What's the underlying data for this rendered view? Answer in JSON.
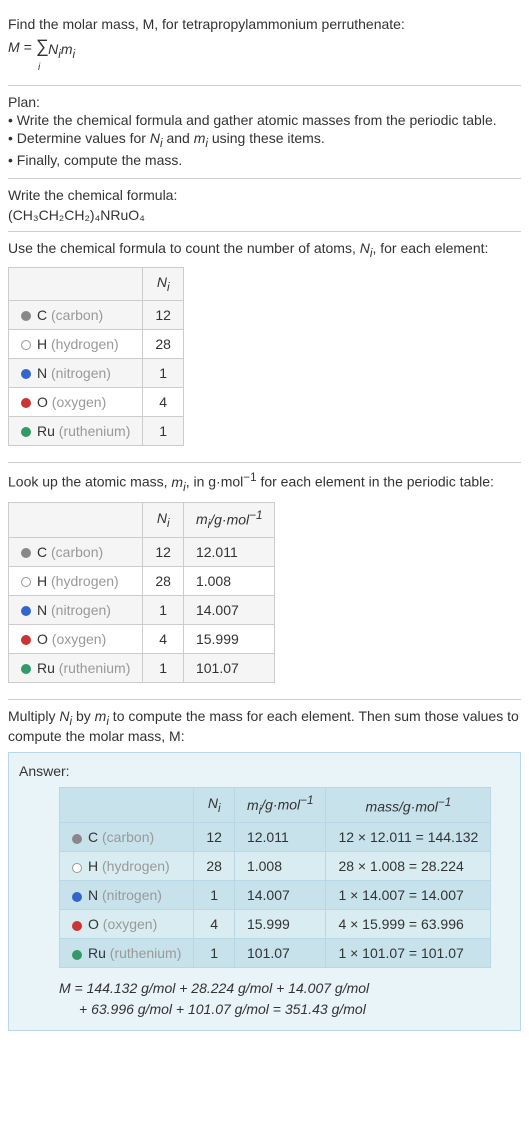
{
  "intro": {
    "line1": "Find the molar mass, M, for tetrapropylammonium perruthenate:",
    "formula_text": "M = ",
    "sigma": "∑",
    "sigma_sub": "i",
    "formula_rest": " Nᵢmᵢ"
  },
  "plan": {
    "heading": "Plan:",
    "item1": "• Write the chemical formula and gather atomic masses from the periodic table.",
    "item2_pre": "• Determine values for ",
    "item2_n": "Nᵢ",
    "item2_mid": " and ",
    "item2_m": "mᵢ",
    "item2_post": " using these items.",
    "item3": "• Finally, compute the mass."
  },
  "chem_formula": {
    "heading": "Write the chemical formula:",
    "formula": "(CH₃CH₂CH₂)₄NRuO₄"
  },
  "count_section": {
    "heading_pre": "Use the chemical formula to count the number of atoms, ",
    "heading_var": "Nᵢ",
    "heading_post": ", for each element:",
    "col_n": "Nᵢ",
    "rows": {
      "c": {
        "sym": "C",
        "name": "(carbon)",
        "n": "12"
      },
      "h": {
        "sym": "H",
        "name": "(hydrogen)",
        "n": "28"
      },
      "n": {
        "sym": "N",
        "name": "(nitrogen)",
        "n": "1"
      },
      "o": {
        "sym": "O",
        "name": "(oxygen)",
        "n": "4"
      },
      "ru": {
        "sym": "Ru",
        "name": "(ruthenium)",
        "n": "1"
      }
    }
  },
  "mass_section": {
    "heading_pre": "Look up the atomic mass, ",
    "heading_var": "mᵢ",
    "heading_mid": ", in g·mol",
    "heading_exp": "−1",
    "heading_post": " for each element in the periodic table:",
    "col_n": "Nᵢ",
    "col_m_pre": "mᵢ",
    "col_m_mid": "/g·mol",
    "col_m_exp": "−1",
    "rows": {
      "c": {
        "sym": "C",
        "name": "(carbon)",
        "n": "12",
        "m": "12.011"
      },
      "h": {
        "sym": "H",
        "name": "(hydrogen)",
        "n": "28",
        "m": "1.008"
      },
      "n": {
        "sym": "N",
        "name": "(nitrogen)",
        "n": "1",
        "m": "14.007"
      },
      "o": {
        "sym": "O",
        "name": "(oxygen)",
        "n": "4",
        "m": "15.999"
      },
      "ru": {
        "sym": "Ru",
        "name": "(ruthenium)",
        "n": "1",
        "m": "101.07"
      }
    }
  },
  "multiply_section": {
    "heading_pre": "Multiply ",
    "heading_n": "Nᵢ",
    "heading_mid1": " by ",
    "heading_m": "mᵢ",
    "heading_post": " to compute the mass for each element. Then sum those values to compute the molar mass, M:"
  },
  "answer": {
    "label": "Answer:",
    "col_n": "Nᵢ",
    "col_m_pre": "mᵢ",
    "col_m_mid": "/g·mol",
    "col_m_exp": "−1",
    "col_mass_pre": "mass/g·mol",
    "col_mass_exp": "−1",
    "rows": {
      "c": {
        "sym": "C",
        "name": "(carbon)",
        "n": "12",
        "m": "12.011",
        "calc": "12 × 12.011 = 144.132"
      },
      "h": {
        "sym": "H",
        "name": "(hydrogen)",
        "n": "28",
        "m": "1.008",
        "calc": "28 × 1.008 = 28.224"
      },
      "n": {
        "sym": "N",
        "name": "(nitrogen)",
        "n": "1",
        "m": "14.007",
        "calc": "1 × 14.007 = 14.007"
      },
      "o": {
        "sym": "O",
        "name": "(oxygen)",
        "n": "4",
        "m": "15.999",
        "calc": "4 × 15.999 = 63.996"
      },
      "ru": {
        "sym": "Ru",
        "name": "(ruthenium)",
        "n": "1",
        "m": "101.07",
        "calc": "1 × 101.07 = 101.07"
      }
    },
    "final1": "M = 144.132 g/mol + 28.224 g/mol + 14.007 g/mol",
    "final2": "+ 63.996 g/mol + 101.07 g/mol = 351.43 g/mol"
  }
}
